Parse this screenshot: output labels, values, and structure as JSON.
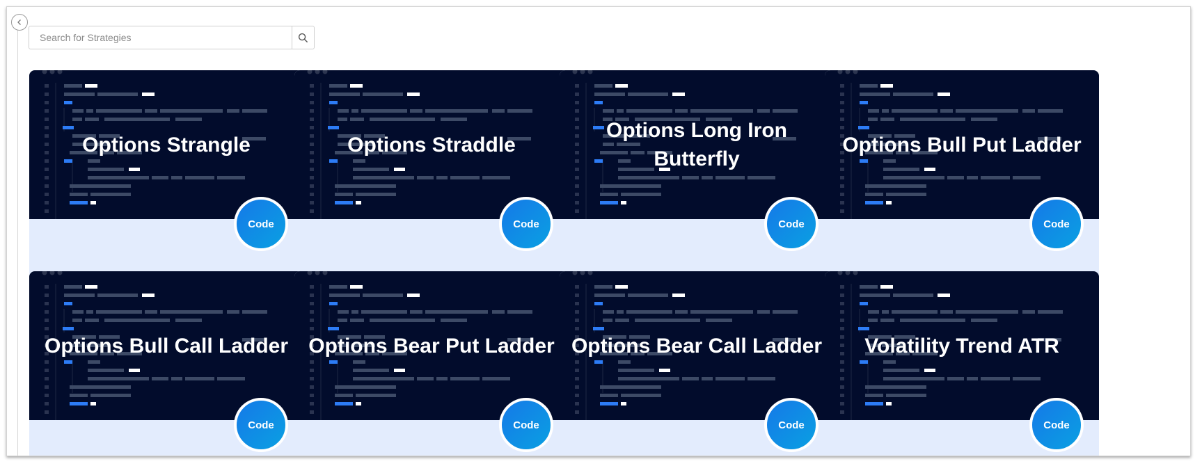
{
  "back_button": {
    "icon": "chevron-left-icon"
  },
  "search": {
    "placeholder": "Search for Strategies",
    "value": "",
    "icon": "search-icon"
  },
  "strategies": [
    {
      "title": "Options Strangle",
      "button_label": "Code"
    },
    {
      "title": "Options Straddle",
      "button_label": "Code"
    },
    {
      "title": "Options Long Iron Butterfly",
      "button_label": "Code"
    },
    {
      "title": "Options Bull Put Ladder",
      "button_label": "Code"
    },
    {
      "title": "Options Bull Call Ladder",
      "button_label": "Code"
    },
    {
      "title": "Options Bear Put Ladder",
      "button_label": "Code"
    },
    {
      "title": "Options Bear Call Ladder",
      "button_label": "Code"
    },
    {
      "title": "Volatility Trend ATR",
      "button_label": "Code"
    }
  ],
  "colors": {
    "card_header_bg": "#020c2c",
    "card_footer_bg": "#e3ecfd",
    "button_gradient_start": "#1579e8",
    "button_gradient_end": "#0aa0e2",
    "code_accent": "#2d7cf6"
  }
}
